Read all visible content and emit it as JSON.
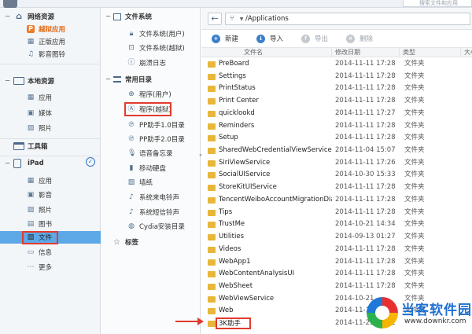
{
  "topbar": {
    "search_placeholder": "搜索文件和应用"
  },
  "sidebar": {
    "network": {
      "label": "网络资源",
      "items": [
        {
          "label": "越狱应用",
          "icon": "p-app-icon"
        },
        {
          "label": "正版应用",
          "icon": "grid-icon"
        },
        {
          "label": "影音图铃",
          "icon": "music-icon"
        }
      ]
    },
    "local": {
      "label": "本地资源",
      "items": [
        {
          "label": "应用",
          "icon": "grid-icon"
        },
        {
          "label": "媒体",
          "icon": "film-icon"
        },
        {
          "label": "照片",
          "icon": "photo-icon"
        }
      ]
    },
    "toolbox": {
      "label": "工具箱"
    },
    "ipad": {
      "label": "iPad",
      "items": [
        {
          "label": "应用",
          "icon": "grid-icon"
        },
        {
          "label": "影音",
          "icon": "film-icon"
        },
        {
          "label": "照片",
          "icon": "photo-icon"
        },
        {
          "label": "图书",
          "icon": "book-icon"
        },
        {
          "label": "文件",
          "icon": "file-icon"
        },
        {
          "label": "信息",
          "icon": "chat-icon"
        },
        {
          "label": "更多",
          "icon": "more-icon"
        }
      ]
    }
  },
  "middle": {
    "filesystem": {
      "label": "文件系统",
      "items": [
        {
          "label": "文件系统(用户)"
        },
        {
          "label": "文件系统(越狱)"
        },
        {
          "label": "崩溃日志"
        }
      ]
    },
    "common": {
      "label": "常用目录",
      "items": [
        {
          "label": "程序(用户)"
        },
        {
          "label": "程序(越狱)"
        },
        {
          "label": "PP助手1.0目录"
        },
        {
          "label": "PP助手2.0目录"
        },
        {
          "label": "语音备忘录"
        },
        {
          "label": "移动硬盘"
        },
        {
          "label": "墙纸"
        },
        {
          "label": "系统来电铃声"
        },
        {
          "label": "系统短信铃声"
        },
        {
          "label": "Cydia安装目录"
        }
      ]
    },
    "bookmarks": {
      "label": "标签"
    }
  },
  "pathbar": {
    "path": "/Applications"
  },
  "toolbar": {
    "new": "新建",
    "import": "导入",
    "export": "导出",
    "delete": "删除"
  },
  "table": {
    "headers": {
      "name": "文件名",
      "date": "修改日期",
      "type": "类型",
      "size": "大小"
    },
    "rows": [
      {
        "name": "PreBoard",
        "date": "2014-11-11 17:28",
        "type": "文件夹"
      },
      {
        "name": "Settings",
        "date": "2014-11-11 17:28",
        "type": "文件夹"
      },
      {
        "name": "PrintStatus",
        "date": "2014-11-11 17:28",
        "type": "文件夹"
      },
      {
        "name": "Print Center",
        "date": "2014-11-11 17:28",
        "type": "文件夹"
      },
      {
        "name": "quicklookd",
        "date": "2014-11-11 17:27",
        "type": "文件夹"
      },
      {
        "name": "Reminders",
        "date": "2014-11-11 17:28",
        "type": "文件夹"
      },
      {
        "name": "Setup",
        "date": "2014-11-11 17:28",
        "type": "文件夹"
      },
      {
        "name": "SharedWebCredentialViewService",
        "date": "2014-11-04 15:07",
        "type": "文件夹"
      },
      {
        "name": "SiriViewService",
        "date": "2014-11-11 17:26",
        "type": "文件夹"
      },
      {
        "name": "SocialUIService",
        "date": "2014-10-30 15:33",
        "type": "文件夹"
      },
      {
        "name": "StoreKitUIService",
        "date": "2014-11-11 17:28",
        "type": "文件夹"
      },
      {
        "name": "TencentWeiboAccountMigrationDia...",
        "date": "2014-11-11 17:28",
        "type": "文件夹"
      },
      {
        "name": "Tips",
        "date": "2014-11-11 17:28",
        "type": "文件夹"
      },
      {
        "name": "TrustMe",
        "date": "2014-10-21 14:34",
        "type": "文件夹"
      },
      {
        "name": "Utilities",
        "date": "2014-09-13 01:27",
        "type": "文件夹"
      },
      {
        "name": "Videos",
        "date": "2014-11-11 17:28",
        "type": "文件夹"
      },
      {
        "name": "WebApp1",
        "date": "2014-11-11 17:28",
        "type": "文件夹"
      },
      {
        "name": "WebContentAnalysisUI",
        "date": "2014-11-11 17:28",
        "type": "文件夹"
      },
      {
        "name": "WebSheet",
        "date": "2014-11-11 17:28",
        "type": "文件夹"
      },
      {
        "name": "WebViewService",
        "date": "2014-10-21",
        "type": "文件夹"
      },
      {
        "name": "Web",
        "date": "2014-11-11 17:28",
        "type": "文件夹"
      },
      {
        "name": "3K助手",
        "date": "2014-11-29 16:41",
        "type": ""
      }
    ]
  },
  "watermark": {
    "title": "当客软件园",
    "url": "www.downkr.com"
  },
  "colors": {
    "selected": "#5da8e6",
    "highlight_box": "#e23b2e",
    "accent": "#3c7fc8",
    "hot": "#e06a1a"
  }
}
